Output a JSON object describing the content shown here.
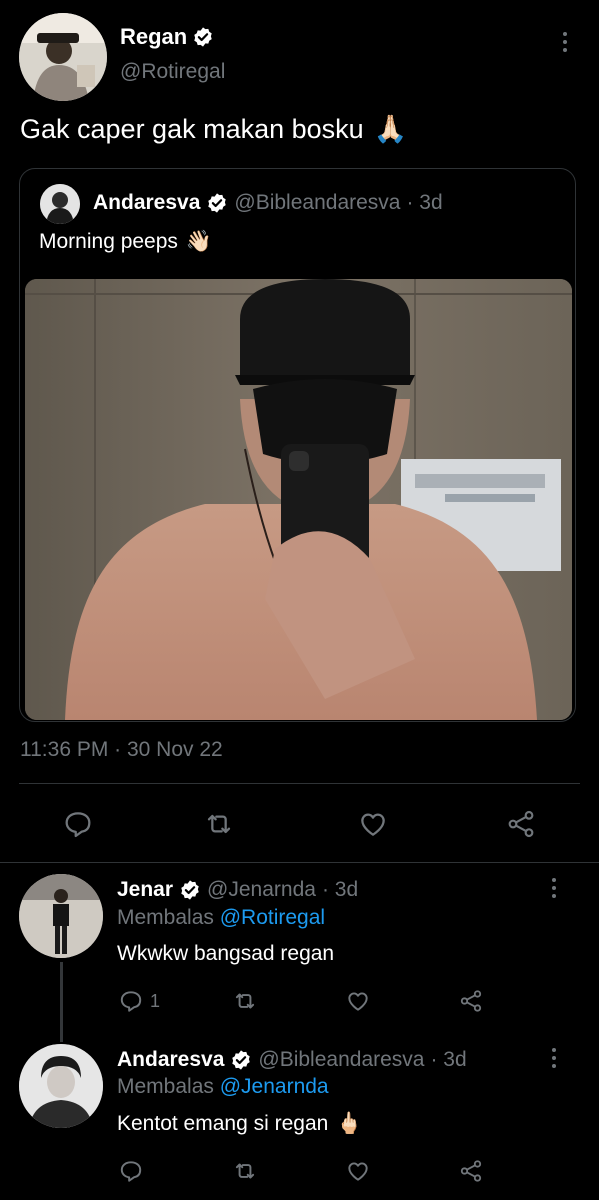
{
  "main_tweet": {
    "name": "Regan",
    "handle": "@Rotiregal",
    "text": "Gak caper gak makan bosku",
    "emoji": "🙏🏻",
    "timestamp": "11:36 PM · 30 Nov 22"
  },
  "quoted_tweet": {
    "name": "Andaresva",
    "handle": "@Bibleandaresva",
    "age": "· 3d",
    "text": "Morning peeps",
    "emoji": "👋🏻"
  },
  "replies": [
    {
      "name": "Jenar",
      "handle": "@Jenarnda",
      "age": "· 3d",
      "replying_label": "Membalas",
      "replying_to": "@Rotiregal",
      "text": "Wkwkw bangsad regan",
      "emoji": "",
      "reply_count": "1"
    },
    {
      "name": "Andaresva",
      "handle": "@Bibleandaresva",
      "age": "· 3d",
      "replying_label": "Membalas",
      "replying_to": "@Jenarnda",
      "text": "Kentot emang si regan",
      "emoji": "🖕🏻",
      "reply_count": ""
    }
  ],
  "icons": {
    "reply": "reply-icon",
    "retweet": "retweet-icon",
    "like": "heart-icon",
    "share": "share-icon",
    "more": "more-options-icon",
    "verified": "verified-badge-icon"
  },
  "colors": {
    "background": "#000000",
    "text": "#e7e9ea",
    "muted": "#71767b",
    "link": "#1d9bf0"
  }
}
